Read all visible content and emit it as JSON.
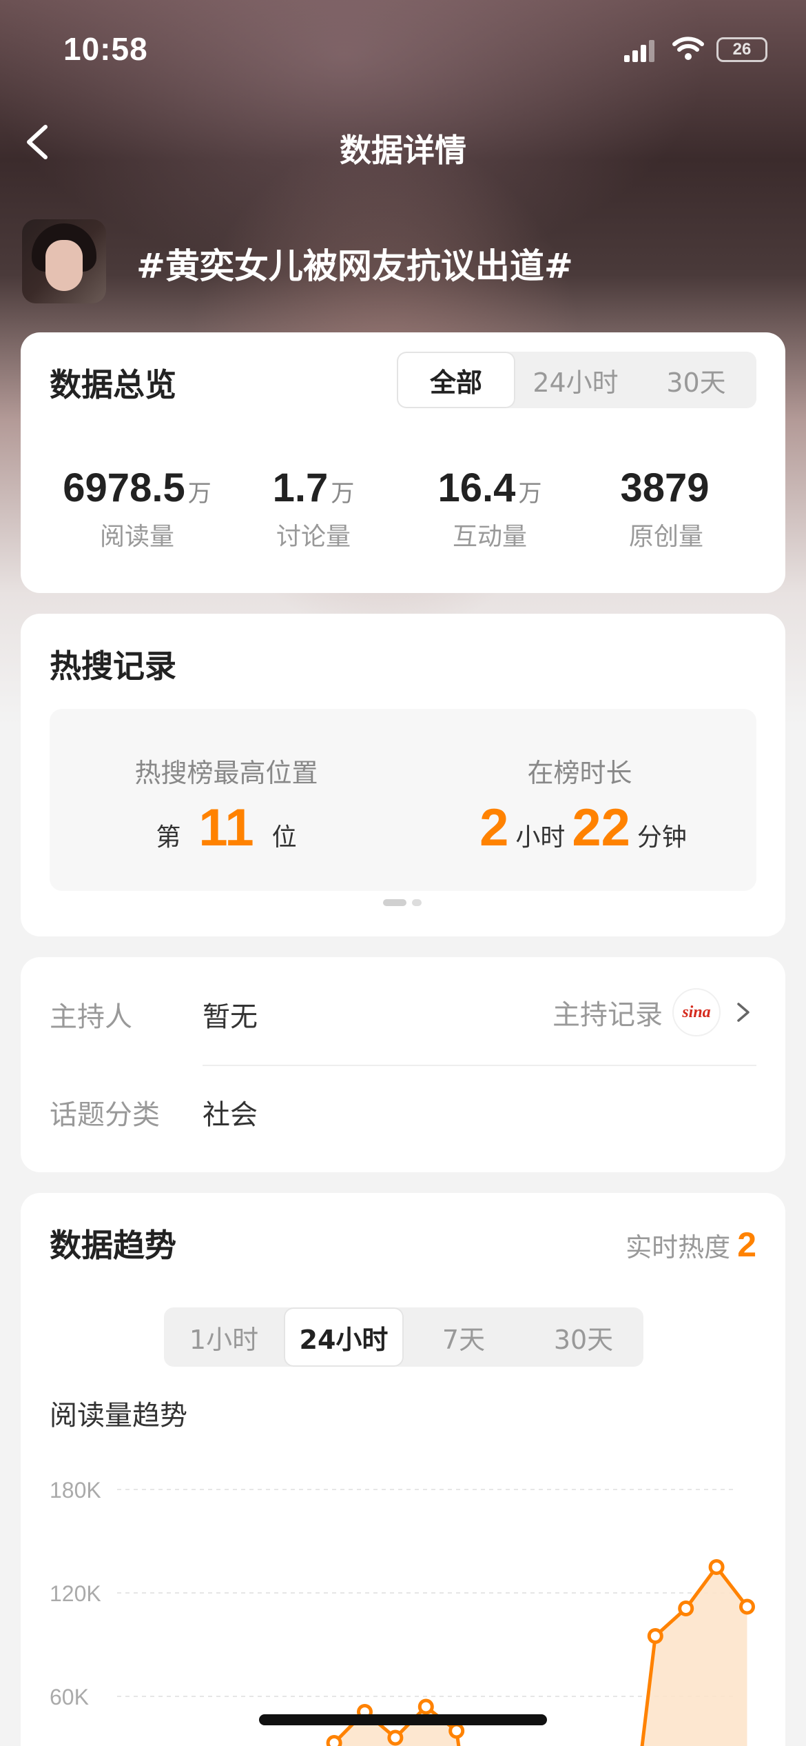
{
  "status_bar": {
    "time": "10:58",
    "battery": "26"
  },
  "nav": {
    "title": "数据详情"
  },
  "topic": {
    "title": "#黄奕女儿被网友抗议出道#"
  },
  "overview": {
    "heading": "数据总览",
    "tabs": [
      {
        "label": "全部",
        "active": true
      },
      {
        "label": "24小时",
        "active": false
      },
      {
        "label": "30天",
        "active": false
      }
    ],
    "stats": [
      {
        "value": "6978.5",
        "unit": "万",
        "label": "阅读量"
      },
      {
        "value": "1.7",
        "unit": "万",
        "label": "讨论量"
      },
      {
        "value": "16.4",
        "unit": "万",
        "label": "互动量"
      },
      {
        "value": "3879",
        "unit": "",
        "label": "原创量"
      }
    ]
  },
  "hot_search": {
    "heading": "热搜记录",
    "peak": {
      "label": "热搜榜最高位置",
      "prefix": "第",
      "value": "11",
      "suffix": "位"
    },
    "duration": {
      "label": "在榜时长",
      "hours": "2",
      "hours_unit": "小时",
      "minutes": "22",
      "minutes_unit": "分钟"
    }
  },
  "info": {
    "host_label": "主持人",
    "host_value": "暂无",
    "host_record_link": "主持记录",
    "host_record_logo": "sina",
    "category_label": "话题分类",
    "category_value": "社会"
  },
  "trend": {
    "heading": "数据趋势",
    "realtime_label": "实时热度",
    "realtime_value": "2",
    "tabs": [
      {
        "label": "1小时",
        "active": false
      },
      {
        "label": "24小时",
        "active": true
      },
      {
        "label": "7天",
        "active": false
      },
      {
        "label": "30天",
        "active": false
      }
    ],
    "chart_subtitle": "阅读量趋势"
  },
  "colors": {
    "accent": "#ff8200",
    "area_fill": "#fde3c8"
  },
  "chart_data": {
    "type": "area",
    "title": "阅读量趋势",
    "y_ticks": [
      "180K",
      "120K",
      "60K"
    ],
    "ylim": [
      0,
      180000
    ],
    "grid": true,
    "series": [
      {
        "points": [
          [
            0.41,
            33000
          ],
          [
            0.45,
            51000
          ],
          [
            0.49,
            36000
          ],
          [
            0.53,
            54000
          ],
          [
            0.57,
            40000
          ],
          [
            0.83,
            95000
          ],
          [
            0.87,
            111000
          ],
          [
            0.91,
            135000
          ],
          [
            0.95,
            112000
          ]
        ]
      }
    ]
  }
}
